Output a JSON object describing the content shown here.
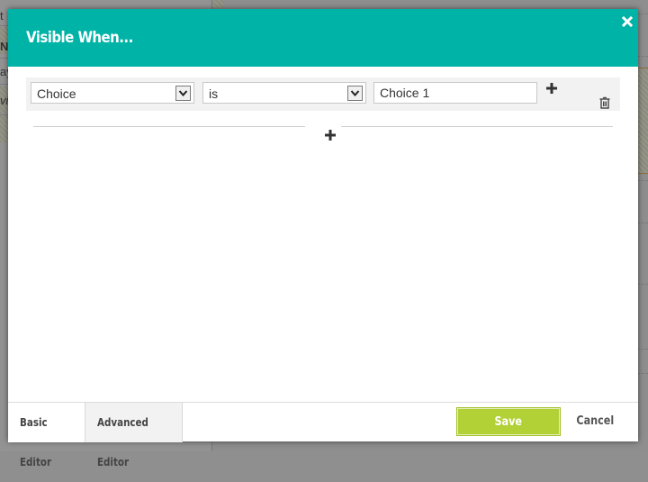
{
  "background": {
    "fragments": [
      "t",
      "N",
      "ay",
      "vic"
    ]
  },
  "dialog": {
    "title": "Visible When...",
    "close_icon": "close-icon",
    "condition": {
      "field": {
        "selected": "Choice"
      },
      "operator": {
        "selected": "is"
      },
      "value": "Choice 1",
      "add_icon": "plus-icon",
      "delete_icon": "trash-icon"
    },
    "add_group_icon": "plus-icon"
  },
  "footer": {
    "tabs": [
      {
        "label": "Basic Editor",
        "active": true
      },
      {
        "label": "Advanced Editor",
        "active": false
      }
    ],
    "save_label": "Save",
    "cancel_label": "Cancel"
  },
  "colors": {
    "header": "#00b3a7",
    "save_button": "#b2d136"
  }
}
